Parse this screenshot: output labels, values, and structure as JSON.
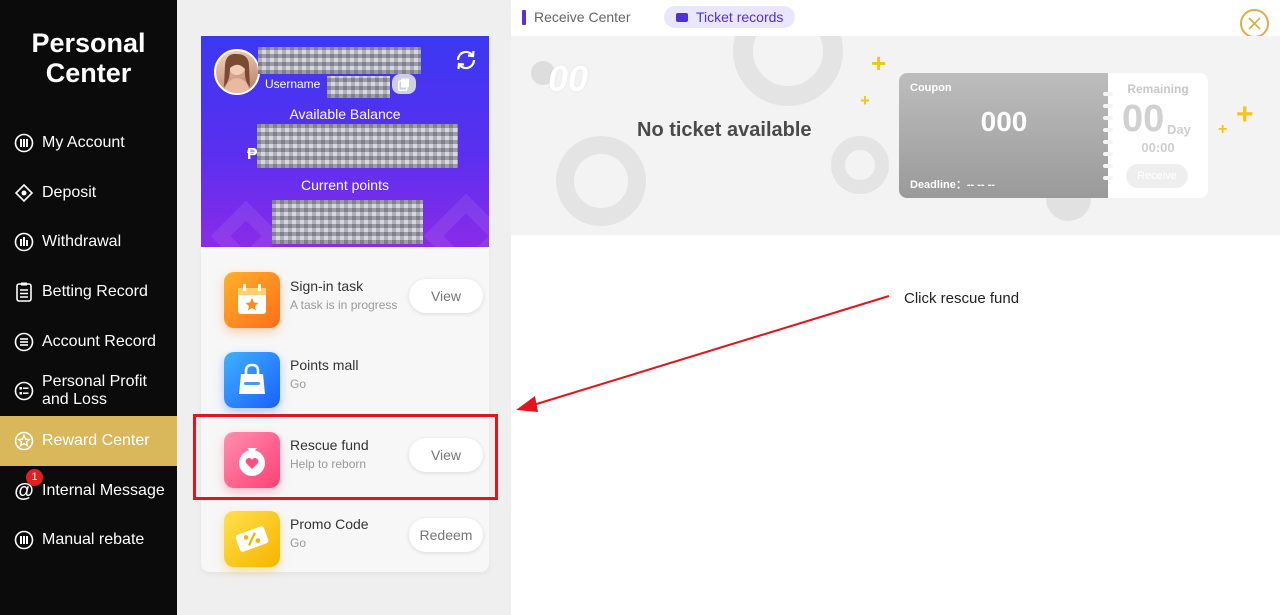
{
  "sidebar": {
    "title_line1": "Personal",
    "title_line2": "Center",
    "items": [
      {
        "label": "My Account",
        "icon": "account-icon"
      },
      {
        "label": "Deposit",
        "icon": "deposit-icon"
      },
      {
        "label": "Withdrawal",
        "icon": "withdrawal-icon"
      },
      {
        "label": "Betting Record",
        "icon": "betting-record-icon"
      },
      {
        "label": "Account Record",
        "icon": "account-record-icon"
      },
      {
        "label": "Personal Profit and Loss",
        "icon": "profit-loss-icon"
      },
      {
        "label": "Reward Center",
        "icon": "reward-icon",
        "active": true
      },
      {
        "label": "Internal Message",
        "icon": "message-icon",
        "badge": "1"
      },
      {
        "label": "Manual rebate",
        "icon": "rebate-icon"
      }
    ],
    "active_color": "#d8b85a"
  },
  "profile": {
    "username_label": "Username",
    "balance_label": "Available Balance",
    "currency_symbol": "₱",
    "points_label": "Current points",
    "card_color": "#4a33f0"
  },
  "tasks": [
    {
      "title": "Sign-in task",
      "subtitle": "A task is in progress",
      "button": "View",
      "icon": "calendar-star-icon"
    },
    {
      "title": "Points mall",
      "subtitle": "Go",
      "button": "",
      "icon": "shopping-bag-icon"
    },
    {
      "title": "Rescue fund",
      "subtitle": "Help to reborn",
      "button": "View",
      "icon": "heart-pouch-icon"
    },
    {
      "title": "Promo Code",
      "subtitle": "Go",
      "button": "Redeem",
      "icon": "coupon-percent-icon"
    }
  ],
  "tabs": {
    "receive_center": "Receive Center",
    "ticket_records": "Ticket records"
  },
  "coupon_area": {
    "big_number": "00",
    "empty_message": "No ticket available",
    "coupon_label": "Coupon",
    "coupon_value": "000",
    "deadline": "Deadline：-- -- --",
    "remaining_label": "Remaining",
    "remaining_days": "00",
    "day_unit": "Day",
    "remaining_time": "00:00",
    "receive_button": "Receive"
  },
  "annotation": {
    "text": "Click rescue fund",
    "color": "#e3141c"
  }
}
